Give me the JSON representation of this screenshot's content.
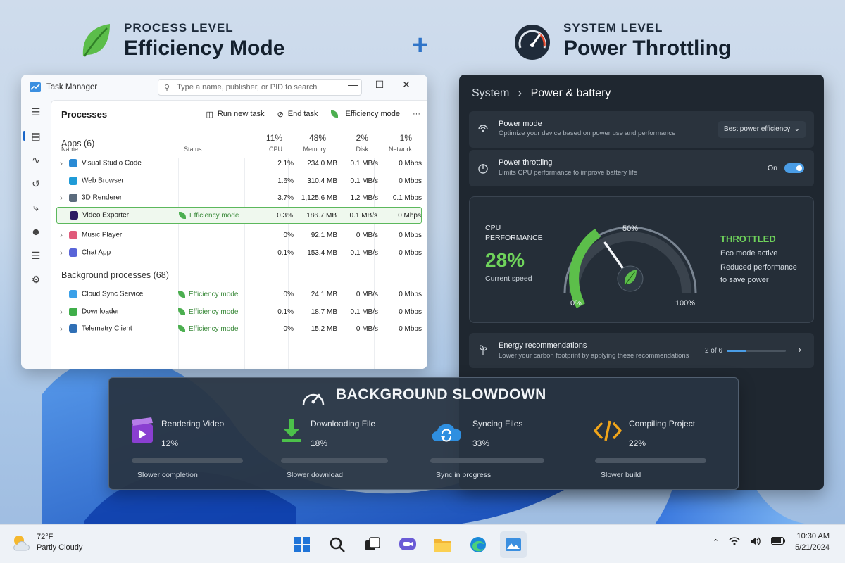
{
  "header": {
    "left_kicker": "PROCESS LEVEL",
    "left_title": "Efficiency Mode",
    "plus": "+",
    "right_kicker": "SYSTEM LEVEL",
    "right_title": "Power Throttling"
  },
  "task_manager": {
    "title": "Task Manager",
    "search_placeholder": "Type a name, publisher, or PID to search",
    "controls": {
      "minimize": "—",
      "maximize": "☐",
      "close": "✕"
    },
    "toolbar": {
      "title": "Processes",
      "run_new_task": "Run new task",
      "end_task": "End task",
      "efficiency_mode": "Efficiency mode",
      "more": "···"
    },
    "columns": {
      "name": "Name",
      "status": "Status",
      "cpu_pct": "11%",
      "cpu": "CPU",
      "mem_pct": "48%",
      "mem": "Memory",
      "disk_pct": "2%",
      "disk": "Disk",
      "net_pct": "1%",
      "net": "Network"
    },
    "apps_group": "Apps (6)",
    "apps": [
      {
        "name": "Visual Studio Code",
        "status": "",
        "cpu": "2.1%",
        "mem": "234.0 MB",
        "disk": "0.1 MB/s",
        "net": "0 Mbps",
        "color": "#2a8ad4"
      },
      {
        "name": "Web Browser",
        "status": "",
        "cpu": "1.6%",
        "mem": "310.4 MB",
        "disk": "0.1 MB/s",
        "net": "0 Mbps",
        "color": "#1f9bd7"
      },
      {
        "name": "3D Renderer",
        "status": "",
        "cpu": "3.7%",
        "mem": "1,125.6 MB",
        "disk": "1.2 MB/s",
        "net": "0.1 Mbps",
        "color": "#5b6b7d"
      },
      {
        "name": "Video Exporter",
        "status": "Efficiency mode",
        "cpu": "0.3%",
        "mem": "186.7 MB",
        "disk": "0.1 MB/s",
        "net": "0 Mbps",
        "color": "#2b1a63"
      },
      {
        "name": "Music Player",
        "status": "",
        "cpu": "0%",
        "mem": "92.1 MB",
        "disk": "0 MB/s",
        "net": "0 Mbps",
        "color": "#e05a7a"
      },
      {
        "name": "Chat App",
        "status": "",
        "cpu": "0.1%",
        "mem": "153.4 MB",
        "disk": "0.1 MB/s",
        "net": "0 Mbps",
        "color": "#5864d8"
      }
    ],
    "bg_group": "Background processes (68)",
    "background": [
      {
        "name": "Cloud Sync Service",
        "status": "Efficiency mode",
        "cpu": "0%",
        "mem": "24.1 MB",
        "disk": "0 MB/s",
        "net": "0 Mbps",
        "color": "#3aa0e8"
      },
      {
        "name": "Downloader",
        "status": "Efficiency mode",
        "cpu": "0.1%",
        "mem": "18.7 MB",
        "disk": "0.1 MB/s",
        "net": "0 Mbps",
        "color": "#3fae4a"
      },
      {
        "name": "Telemetry Client",
        "status": "Efficiency mode",
        "cpu": "0%",
        "mem": "15.2 MB",
        "disk": "0 MB/s",
        "net": "0 Mbps",
        "color": "#2f6fb5"
      }
    ]
  },
  "settings": {
    "breadcrumb_root": "System",
    "breadcrumb_sep": "›",
    "breadcrumb_page": "Power & battery",
    "power_mode": {
      "title": "Power mode",
      "subtitle": "Optimize your device based on power use and performance",
      "value": "Best power efficiency"
    },
    "throttling": {
      "title": "Power throttling",
      "subtitle": "Limits CPU performance to improve battery life",
      "state": "On"
    },
    "gauge": {
      "label1": "CPU",
      "label2": "PERFORMANCE",
      "value": "28%",
      "value_num": 28,
      "caption": "Current speed",
      "tick_0": "0%",
      "tick_50": "50%",
      "tick_100": "100%",
      "status": "THROTTLED",
      "note1": "Eco mode active",
      "note2": "Reduced performance",
      "note3": "to save power"
    },
    "energy": {
      "title": "Energy recommendations",
      "subtitle": "Lower your carbon footprint by applying these recommendations",
      "progress": "2 of 6",
      "progress_fraction": 0.33
    }
  },
  "slowdown": {
    "title": "BACKGROUND SLOWDOWN",
    "jobs": [
      {
        "name": "Rendering Video",
        "pct": "12%",
        "fraction": 0.12,
        "caption": "Slower completion",
        "color": "#8a3fd1"
      },
      {
        "name": "Downloading File",
        "pct": "18%",
        "fraction": 0.18,
        "caption": "Slower download",
        "color": "#3fae4a"
      },
      {
        "name": "Syncing Files",
        "pct": "33%",
        "fraction": 0.33,
        "caption": "Sync in progress",
        "color": "#2f8fe0"
      },
      {
        "name": "Compiling Project",
        "pct": "22%",
        "fraction": 0.22,
        "caption": "Slower build",
        "color": "#f0a51a"
      }
    ]
  },
  "taskbar": {
    "temp": "72°F",
    "weather": "Partly Cloudy",
    "time": "10:30 AM",
    "date": "5/21/2024",
    "apps": [
      "start-icon",
      "search-icon",
      "task-view-icon",
      "chat-icon",
      "file-explorer-icon",
      "edge-icon",
      "photos-icon"
    ]
  }
}
